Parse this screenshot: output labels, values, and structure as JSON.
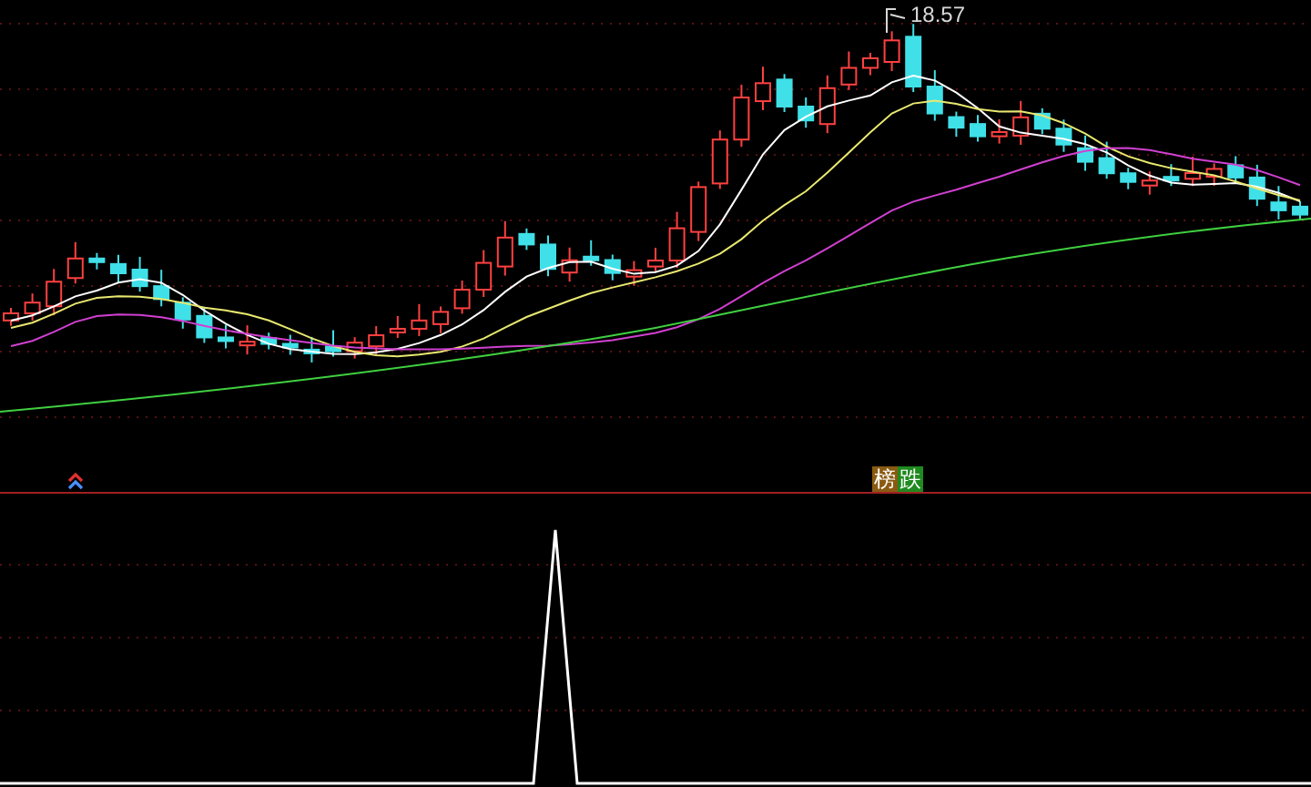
{
  "price_chart": {
    "high_label": "18.57"
  },
  "signal_tags": [
    {
      "text": "榜",
      "color": "#8a5a12"
    },
    {
      "text": "跌",
      "color": "#1f8a1f"
    }
  ]
}
